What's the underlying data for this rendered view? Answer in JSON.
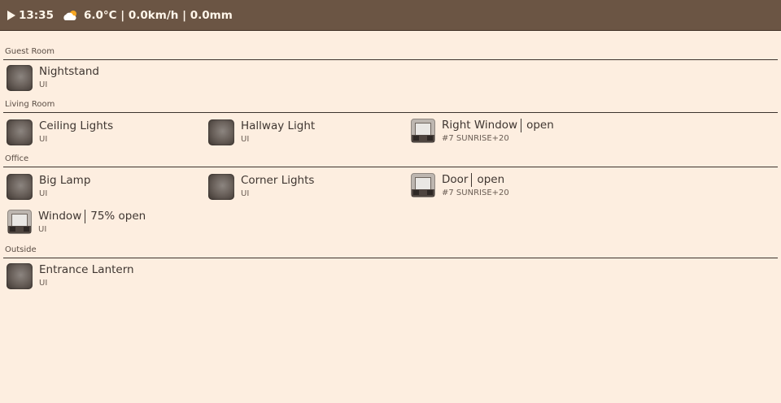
{
  "topbar": {
    "time": "13:35",
    "weather": "6.0°C | 0.0km/h | 0.0mm"
  },
  "sections": {
    "guest_room": {
      "title": "Guest Room",
      "items": [
        {
          "name": "Nightstand",
          "sub": "UI",
          "icon": "light-icon"
        }
      ]
    },
    "living_room": {
      "title": "Living Room",
      "items": [
        {
          "name": "Ceiling Lights",
          "sub": "UI",
          "icon": "light-icon"
        },
        {
          "name": "Hallway Light",
          "sub": "UI",
          "icon": "light-icon"
        },
        {
          "name": "Right Window",
          "state": "open",
          "sub": "#7 SUNRISE+20",
          "icon": "blind-icon"
        }
      ]
    },
    "office": {
      "title": "Office",
      "items": [
        {
          "name": "Big Lamp",
          "sub": "UI",
          "icon": "light-icon"
        },
        {
          "name": "Corner Lights",
          "sub": "UI",
          "icon": "light-icon"
        },
        {
          "name": "Door",
          "state": "open",
          "sub": "#7 SUNRISE+20",
          "icon": "blind-icon"
        },
        {
          "name": "Window",
          "state": "75% open",
          "sub": "UI",
          "icon": "blind-icon"
        }
      ]
    },
    "outside": {
      "title": "Outside",
      "items": [
        {
          "name": "Entrance Lantern",
          "sub": "UI",
          "icon": "light-icon"
        }
      ]
    }
  },
  "colors": {
    "topbar": "#6b5544",
    "background": "#fdeee0"
  }
}
